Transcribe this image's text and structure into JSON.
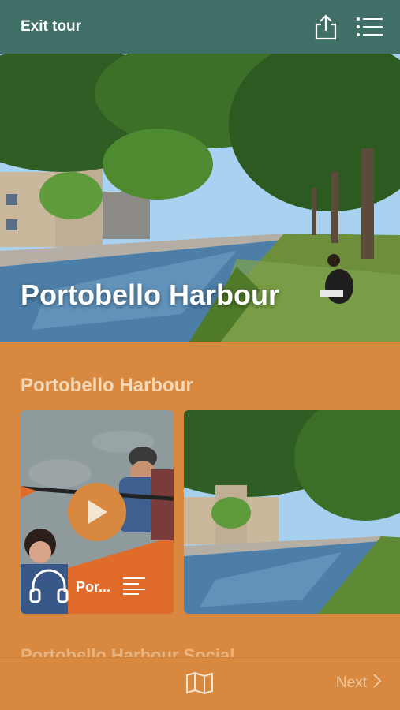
{
  "topbar": {
    "exit_label": "Exit tour",
    "share_icon": "share-icon",
    "list_icon": "list-icon",
    "background": "#3f6f66"
  },
  "hero": {
    "title": "Portobello Harbour"
  },
  "section": {
    "title": "Portobello Harbour",
    "cards": [
      {
        "label": "Portobello Harbour",
        "display_label": "Por...",
        "type": "audio"
      },
      {
        "label": "",
        "type": "image"
      }
    ]
  },
  "next_section": {
    "title": "Portobello Harbour Social"
  },
  "bottombar": {
    "map_icon": "map-icon",
    "next_label": "Next"
  },
  "colors": {
    "accent": "#d9893f",
    "header": "#3f6f66",
    "title_muted": "#f4d8b7"
  }
}
